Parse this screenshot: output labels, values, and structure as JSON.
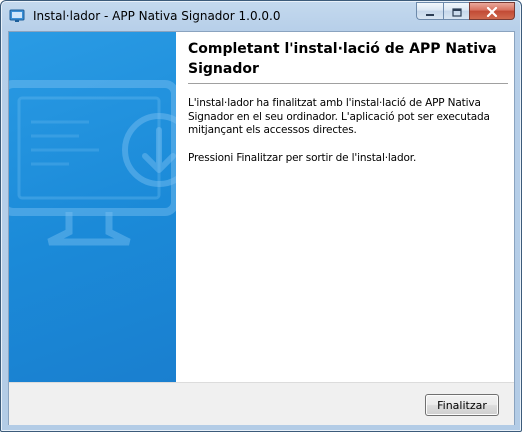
{
  "window": {
    "title": "Instal·lador - APP Nativa Signador 1.0.0.0",
    "buttons": {
      "minimize_icon": "minimize-icon",
      "maximize_icon": "maximize-icon",
      "close_icon": "close-icon"
    }
  },
  "side_panel": {
    "illustration": "monitor-download-icon",
    "color": "#1b8ad8"
  },
  "content": {
    "heading": "Completant l'instal·lació de APP Nativa Signador",
    "paragraph1": "L'instal·lador ha finalitzat amb l'instal·lació de APP Nativa Signador en el seu ordinador. L'aplicació pot ser executada mitjançant els accessos directes.",
    "paragraph2": "Pressioni Finalitzar per sortir de l'instal·lador."
  },
  "footer": {
    "finish_label": "Finalitzar"
  }
}
